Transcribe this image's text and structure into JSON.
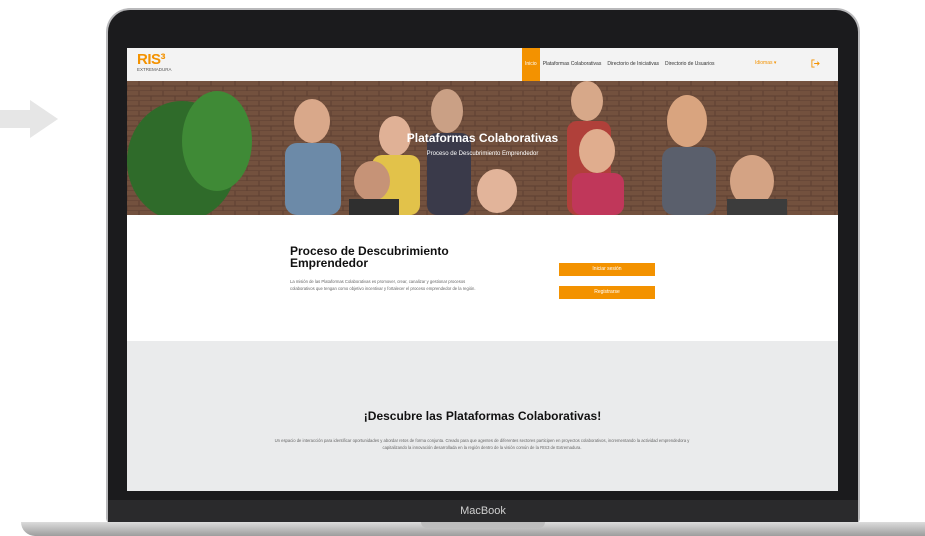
{
  "nav": {
    "logo_text": "RIS³",
    "logo_sub": "EXTREMADURA",
    "items": [
      {
        "label": "Inicio"
      },
      {
        "label": "Plataformas Colaborativas"
      },
      {
        "label": "Directorio de Iniciativas"
      },
      {
        "label": "Directorio de Usuarios"
      }
    ],
    "language_label": "Idiomas ▾"
  },
  "hero": {
    "title": "Plataformas Colaborativas",
    "subtitle": "Proceso de Descubrimiento Emprendedor"
  },
  "intro": {
    "title": "Proceso de Descubrimiento Emprendedor",
    "body": "La misión de las Plataformas Colaborativas es promover, crear, canalizar y gestionar procesos colaborativos que tengan como objetivo incentivar y fortalecer el proceso emprendedor de la región.",
    "login_button": "Iniciar sesión",
    "register_button": "Registrarse"
  },
  "discover": {
    "title": "¡Descubre las Plataformas Colaborativas!",
    "body": "Un espacio de interacción para identificar oportunidades y abordar retos de forma conjunta. Creado para que agentes de diferentes sectores participen en proyectos colaborativos, incrementando la actividad emprendedora y capitalizando la innovación desarrollada en la región dentro de la visión común de la RIS3 de Extremadura."
  },
  "device": {
    "label": "MacBook"
  },
  "colors": {
    "accent": "#f39200",
    "light_section": "#eaebec"
  }
}
